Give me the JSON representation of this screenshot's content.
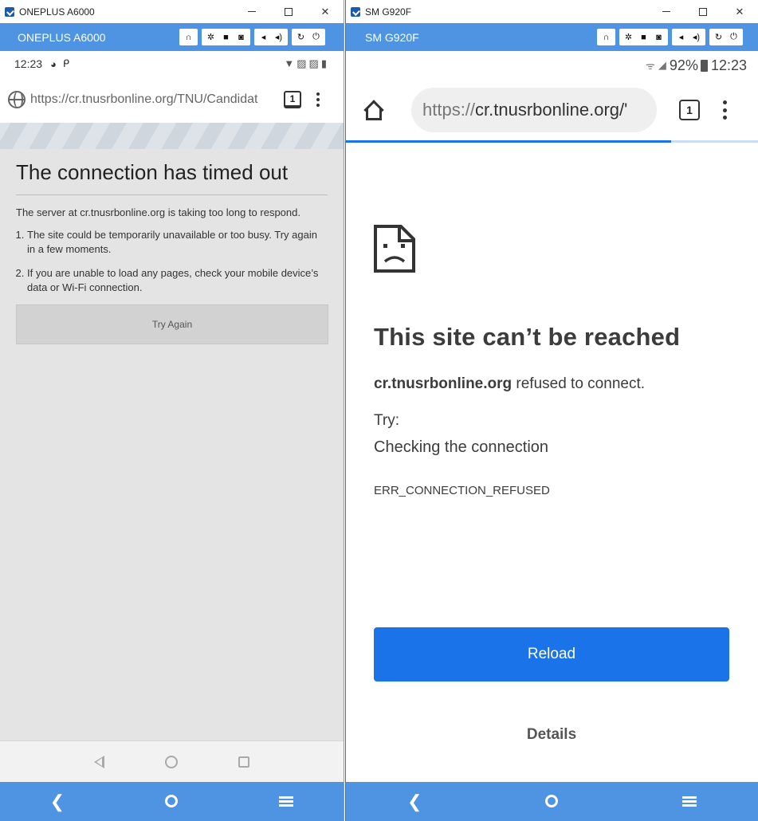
{
  "left_window": {
    "title": "ONEPLUS A6000",
    "device_name": "ONEPLUS A6000",
    "status_time": "12:23",
    "url": "https://cr.tnusrbonline.org/TNU/Candidat",
    "tab_count": "1",
    "error": {
      "title": "The connection has timed out",
      "description": "The server at cr.tnusrbonline.org is taking too long to respond.",
      "items": [
        "The site could be temporarily unavailable or too busy. Try again in a few moments.",
        "If you are unable to load any pages, check your mobile device’s data or Wi-Fi connection."
      ],
      "button": "Try Again"
    }
  },
  "right_window": {
    "title": "SM G920F",
    "device_name": "SM G920F",
    "battery": "92%",
    "status_time": "12:23",
    "url_scheme": "https://",
    "url_host": "cr.tnusrbonline.org/'",
    "tab_count": "1",
    "load_progress": 0.79,
    "error": {
      "title": "This site can’t be reached",
      "host": "cr.tnusrbonline.org",
      "refused": " refused to connect.",
      "try_label": "Try:",
      "suggestion": "Checking the connection",
      "code": "ERR_CONNECTION_REFUSED",
      "reload_button": "Reload",
      "details_button": "Details"
    }
  },
  "window_controls": {
    "minimize": "—",
    "maximize": "☐",
    "close": "✕"
  },
  "colors": {
    "device_bar": "#4f94e2",
    "reload_button": "#1a73e8",
    "progress": "#1a73e8"
  },
  "icons": {
    "toolbar": [
      "headphone-icon",
      "settings-icon",
      "video-icon",
      "camera-icon",
      "volume-down-icon",
      "volume-up-icon",
      "rotate-icon",
      "power-icon"
    ],
    "nav": [
      "back-icon",
      "home-icon",
      "menu-icon"
    ]
  }
}
